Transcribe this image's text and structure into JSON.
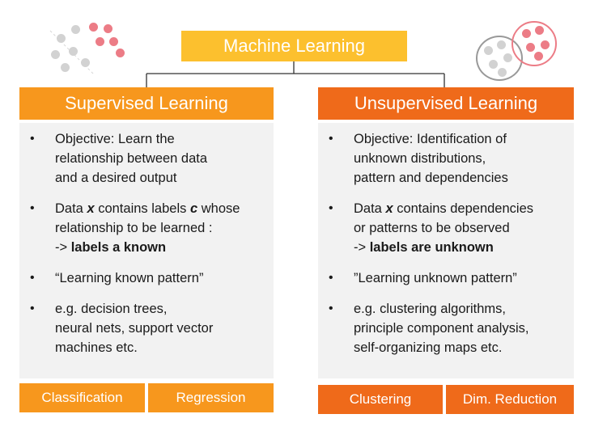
{
  "root": {
    "title": "Machine Learning"
  },
  "supervised": {
    "title": "Supervised Learning",
    "bullets": [
      {
        "lines": [
          "Objective: Learn the",
          "relationship between data",
          "and a desired output"
        ]
      },
      {
        "lines": [
          "",
          "relationship to be learned :",
          ""
        ],
        "l1_a": "Data ",
        "l1_x": "x",
        "l1_b": " contains labels ",
        "l1_c": "c",
        "l1_d": " whose",
        "l3_a": "-> ",
        "l3_bold": "labels a known"
      },
      {
        "lines": [
          "“Learning known pattern”"
        ]
      },
      {
        "lines": [
          "e.g. decision trees,",
          "neural nets, support vector",
          "machines etc."
        ]
      }
    ],
    "categories": [
      "Classification",
      "Regression"
    ]
  },
  "unsupervised": {
    "title": "Unsupervised Learning",
    "bullets": [
      {
        "lines": [
          "Objective: Identification of",
          "unknown distributions,",
          "pattern and dependencies"
        ]
      },
      {
        "lines": [
          "",
          "or patterns to be observed",
          ""
        ],
        "l1_a": "Data ",
        "l1_x": "x",
        "l1_b": " contains dependencies",
        "l3_a": "-> ",
        "l3_bold": "labels are unknown"
      },
      {
        "lines": [
          "”Learning unknown pattern”"
        ]
      },
      {
        "lines": [
          "e.g. clustering algorithms,",
          "principle component analysis,",
          "self-organizing maps etc."
        ]
      }
    ],
    "categories": [
      "Clustering",
      "Dim. Reduction"
    ]
  },
  "colors": {
    "root": "#fcc02e",
    "supervised": "#f7971d",
    "unsupervised": "#ef6a1a",
    "panel": "#f2f2f2",
    "dot_grey": "#d2d2d2",
    "dot_red": "#ec7c86"
  }
}
